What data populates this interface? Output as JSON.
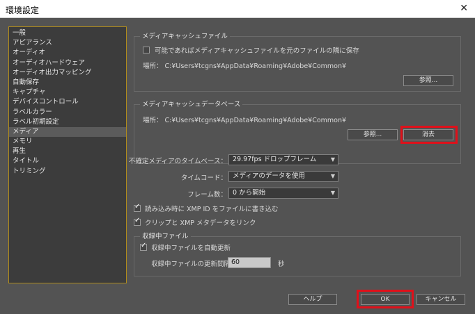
{
  "window": {
    "title": "環境設定",
    "close_glyph": "✕"
  },
  "sidebar": {
    "items": [
      {
        "label": "一般"
      },
      {
        "label": "アピアランス"
      },
      {
        "label": "オーディオ"
      },
      {
        "label": "オーディオハードウェア"
      },
      {
        "label": "オーディオ出力マッピング"
      },
      {
        "label": "自動保存"
      },
      {
        "label": "キャプチャ"
      },
      {
        "label": "デバイスコントロール"
      },
      {
        "label": "ラベルカラー"
      },
      {
        "label": "ラベル初期設定"
      },
      {
        "label": "メディア"
      },
      {
        "label": "メモリ"
      },
      {
        "label": "再生"
      },
      {
        "label": "タイトル"
      },
      {
        "label": "トリミング"
      }
    ],
    "selected_label": "メディア"
  },
  "media_cache_files": {
    "title": "メディアキャッシュファイル",
    "checkbox_label": "可能であればメディアキャッシュファイルを元のファイルの隣に保存",
    "checkbox_checked": false,
    "location": "場所：  C:¥Users¥tcgns¥AppData¥Roaming¥Adobe¥Common¥",
    "browse_label": "参照..."
  },
  "media_cache_db": {
    "title": "メディアキャッシュデータベース",
    "location": "場所：  C:¥Users¥tcgns¥AppData¥Roaming¥Adobe¥Common¥",
    "browse_label": "参照...",
    "clean_label": "消去"
  },
  "settings": {
    "timebase_label": "不確定メディアのタイムベース：",
    "timebase_value": "29.97fps ドロップフレーム",
    "timecode_label": "タイムコード：",
    "timecode_value": "メディアのデータを使用",
    "frame_label": "フレーム数：",
    "frame_value": "0 から開始",
    "xmp_write_label": "読み込み時に XMP ID をファイルに書き込む",
    "xmp_write_checked": true,
    "xmp_link_label": "クリップと XMP メタデータをリンク",
    "xmp_link_checked": true
  },
  "ingest": {
    "title": "収録中ファイル",
    "auto_refresh_label": "収録中ファイルを自動更新",
    "auto_refresh_checked": true,
    "interval_label": "収録中ファイルの更新間隔",
    "interval_value": "60",
    "interval_unit": "秒"
  },
  "footer": {
    "help_label": "ヘルプ",
    "ok_label": "OK",
    "cancel_label": "キャンセル"
  },
  "colors": {
    "background": "#535353",
    "sidebar_border": "#b08c1c",
    "highlight": "#e0101a"
  }
}
